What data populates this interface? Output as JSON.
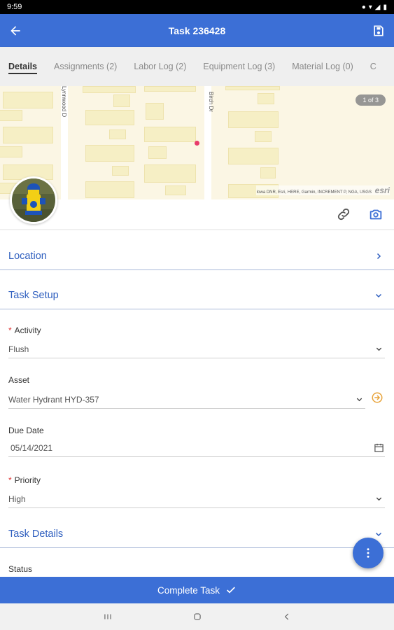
{
  "status_bar": {
    "time": "9:59",
    "icons": [
      "location-icon",
      "wifi-icon",
      "signal-icon",
      "battery-icon"
    ]
  },
  "app_bar": {
    "title": "Task 236428"
  },
  "tabs": [
    {
      "label": "Details",
      "active": true
    },
    {
      "label": "Assignments (2)",
      "active": false
    },
    {
      "label": "Labor Log (2)",
      "active": false
    },
    {
      "label": "Equipment Log (3)",
      "active": false
    },
    {
      "label": "Material Log (0)",
      "active": false
    },
    {
      "label": "C",
      "active": false
    }
  ],
  "map": {
    "page_badge": "1 of 3",
    "streets": [
      "Lynnwood D",
      "Birch Dr"
    ],
    "attribution": "Iowa DNR, Esri, HERE, Garmin, INCREMENT P, NGA, USGS",
    "esri_logo": "esri"
  },
  "sections": {
    "location": "Location",
    "task_setup": "Task Setup",
    "task_details": "Task Details"
  },
  "fields": {
    "activity": {
      "label": "Activity",
      "required": true,
      "value": "Flush"
    },
    "asset": {
      "label": "Asset",
      "required": false,
      "value": "Water Hydrant HYD-357"
    },
    "due_date": {
      "label": "Due Date",
      "required": false,
      "value": "05/14/2021"
    },
    "priority": {
      "label": "Priority",
      "required": true,
      "value": "High"
    },
    "status": {
      "label": "Status"
    }
  },
  "bottom_button": {
    "label": "Complete Task"
  },
  "colors": {
    "primary": "#3c6fd6",
    "section_text": "#2f5fbf",
    "required": "#dd3333",
    "map_marker": "#e83b6b",
    "asset_link": "#e8a33a"
  }
}
